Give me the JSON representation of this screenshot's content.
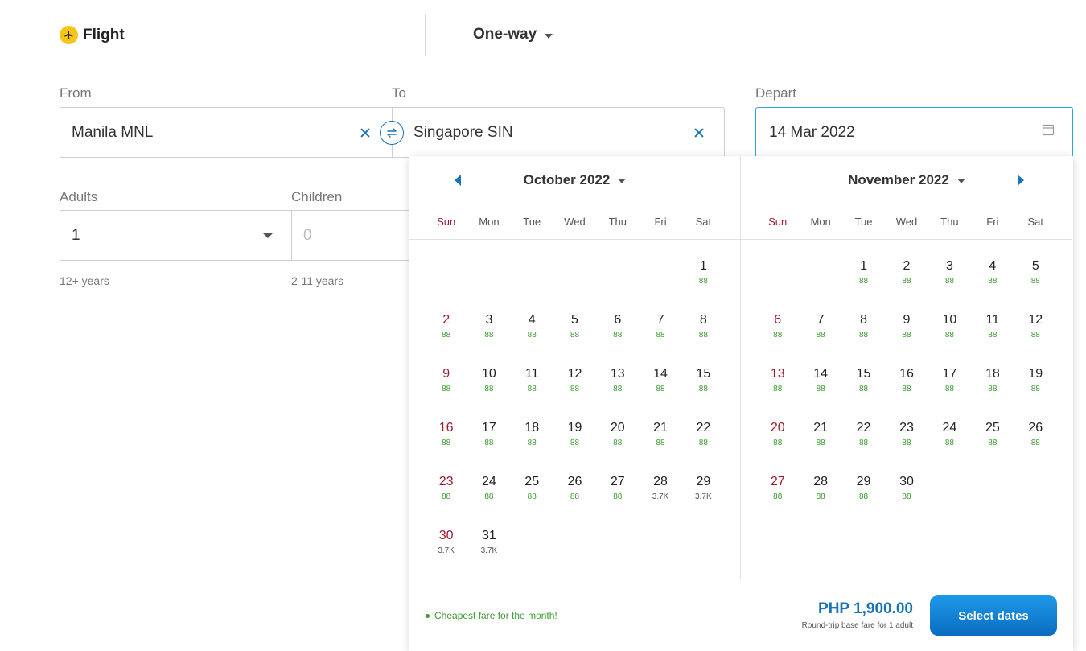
{
  "trip": {
    "type_label": "Flight",
    "way_label": "One-way"
  },
  "from": {
    "label": "From",
    "value": "Manila MNL"
  },
  "to": {
    "label": "To",
    "value": "Singapore SIN"
  },
  "depart": {
    "label": "Depart",
    "value": "14 Mar 2022"
  },
  "adults": {
    "label": "Adults",
    "value": "1",
    "sub": "12+ years"
  },
  "children": {
    "label": "Children",
    "value": "0",
    "sub": "2-11 years"
  },
  "calendar": {
    "weekdays": [
      "Sun",
      "Mon",
      "Tue",
      "Wed",
      "Thu",
      "Fri",
      "Sat"
    ],
    "months": [
      {
        "title": "October 2022",
        "lead_blanks": 6,
        "fares": [
          "88",
          "88",
          "88",
          "88",
          "88",
          "88",
          "88",
          "88",
          "88",
          "88",
          "88",
          "88",
          "88",
          "88",
          "88",
          "88",
          "88",
          "88",
          "88",
          "88",
          "88",
          "88",
          "88",
          "88",
          "88",
          "88",
          "88",
          "3.7K",
          "3.7K",
          "3.7K",
          "3.7K"
        ]
      },
      {
        "title": "November 2022",
        "lead_blanks": 2,
        "fares": [
          "88",
          "88",
          "88",
          "88",
          "88",
          "88",
          "88",
          "88",
          "88",
          "88",
          "88",
          "88",
          "88",
          "88",
          "88",
          "88",
          "88",
          "88",
          "88",
          "88",
          "88",
          "88",
          "88",
          "88",
          "88",
          "88",
          "88",
          "88",
          "88",
          "88"
        ]
      }
    ],
    "legend": "Cheapest fare for the month!",
    "price": "PHP 1,900.00",
    "price_note": "Round-trip base fare for 1 adult",
    "select_label": "Select dates"
  },
  "colors": {
    "accent": "#1a73b8",
    "sunday": "#9b1c2e",
    "cheap": "#3b9a2f",
    "badge": "#f5c518"
  }
}
